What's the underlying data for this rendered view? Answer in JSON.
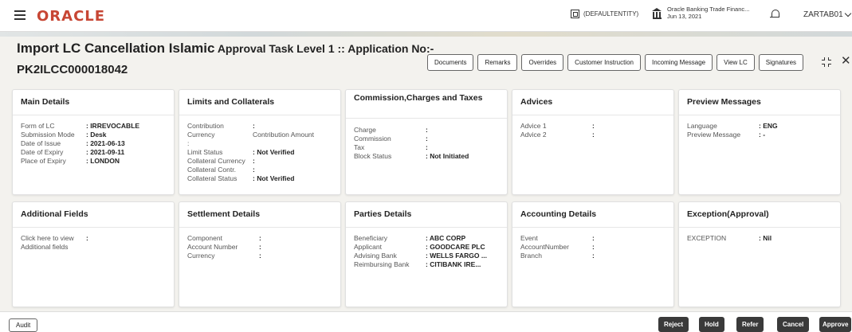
{
  "header": {
    "logo": "ORACLE",
    "entity": "(DEFAULTENTITY)",
    "bank_name": "Oracle Banking Trade Financ...",
    "bank_date": "Jun 13, 2021",
    "user": "ZARTAB01"
  },
  "page": {
    "title_main": "Import LC Cancellation Islamic",
    "title_rest": " Approval Task Level 1 :: Application No:-",
    "application_no": "PK2ILCC000018042"
  },
  "toolbar": {
    "buttons": [
      "Documents",
      "Remarks",
      "Overrides",
      "Customer Instruction",
      "Incoming Message",
      "View LC",
      "Signatures"
    ]
  },
  "cards": {
    "main_details": {
      "title": "Main Details",
      "rows": [
        {
          "label": "Form of LC",
          "value": ": IRREVOCABLE"
        },
        {
          "label": "Submission Mode",
          "value": ": Desk"
        },
        {
          "label": "Date of Issue",
          "value": ": 2021-06-13"
        },
        {
          "label": "Date of Expiry",
          "value": ": 2021-09-11"
        },
        {
          "label": "Place of Expiry",
          "value": ": LONDON"
        }
      ]
    },
    "limits": {
      "title": "Limits and Collaterals",
      "contribution_label": "Contribution",
      "currency_label": "Currency",
      "contribution_amount_label": "Contribution Amount",
      "colon": ":",
      "rows": [
        {
          "label": "Limit Status",
          "value": ": Not Verified"
        },
        {
          "label": "Collateral Currency",
          "value": ":"
        },
        {
          "label": "Collateral Contr.",
          "value": ":"
        },
        {
          "label": "Collateral Status",
          "value": ": Not Verified"
        }
      ]
    },
    "commission": {
      "title": "Commission,Charges and Taxes",
      "rows": [
        {
          "label": "Charge",
          "value": ":"
        },
        {
          "label": "Commission",
          "value": ":"
        },
        {
          "label": "Tax",
          "value": ":"
        },
        {
          "label": "Block Status",
          "value": ": Not Initiated"
        }
      ]
    },
    "advices": {
      "title": "Advices",
      "rows": [
        {
          "label": "Advice 1",
          "value": ":"
        },
        {
          "label": "Advice 2",
          "value": ":"
        }
      ]
    },
    "preview": {
      "title": "Preview Messages",
      "rows": [
        {
          "label": "Language",
          "value": ": ENG"
        },
        {
          "label": "Preview Message",
          "value": ": -"
        }
      ]
    },
    "additional": {
      "title": "Additional Fields",
      "link_line1": "Click here to view",
      "link_line2": "Additional fields",
      "colon": ":"
    },
    "settlement": {
      "title": "Settlement Details",
      "rows": [
        {
          "label": "Component",
          "value": ":"
        },
        {
          "label": "Account Number",
          "value": ":"
        },
        {
          "label": "Currency",
          "value": ":"
        }
      ]
    },
    "parties": {
      "title": "Parties Details",
      "rows": [
        {
          "label": "Beneficiary",
          "value": ": ABC CORP"
        },
        {
          "label": "Applicant",
          "value": ": GOODCARE PLC"
        },
        {
          "label": "Advising Bank",
          "value": ": WELLS FARGO ..."
        },
        {
          "label": "Reimbursing Bank",
          "value": ": CITIBANK IRE..."
        }
      ]
    },
    "accounting": {
      "title": "Accounting Details",
      "rows": [
        {
          "label": "Event",
          "value": ":"
        },
        {
          "label": "AccountNumber",
          "value": ":"
        },
        {
          "label": "Branch",
          "value": ":"
        }
      ]
    },
    "exception": {
      "title": "Exception(Approval)",
      "rows": [
        {
          "label": "EXCEPTION",
          "value": ": Nil"
        }
      ]
    }
  },
  "footer": {
    "audit": "Audit",
    "reject": "Reject",
    "hold": "Hold",
    "refer": "Refer",
    "cancel": "Cancel",
    "approve": "Approve"
  }
}
